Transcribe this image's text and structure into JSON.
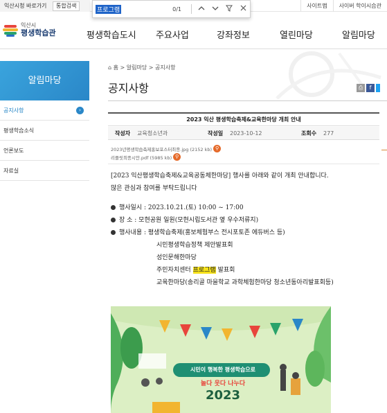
{
  "topbar": {
    "left_link": "익산시청 바로가기",
    "combo": "통합검색",
    "right_links": [
      "사이트맵",
      "사이버 학이시습관"
    ]
  },
  "findbar": {
    "query": "프로그램",
    "count": "0/1"
  },
  "header": {
    "logo_small": "익산시",
    "logo_big": "평생학습관",
    "nav": [
      "평생학습도시",
      "주요사업",
      "강좌정보",
      "열린마당",
      "알림마당"
    ]
  },
  "sidebar": {
    "title": "알림마당",
    "items": [
      "공지사항",
      "평생학습소식",
      "언론보도",
      "자료실"
    ]
  },
  "breadcrumb": "홈 > 알림마당 > 공지사항",
  "page_title": "공지사항",
  "post": {
    "title": "2023 익산 평생학습축제&교육한마당 개최 안내",
    "author_label": "작성자",
    "author": "교육청소년과",
    "date_label": "작성일",
    "date": "2023-10-12",
    "views_label": "조회수",
    "views": "277",
    "attachments": [
      "2023년평생학습축제홍보포스터최종.jpg (2152 kb)",
      "리플릿최종시안.pdf (5985 kb)"
    ],
    "intro_line1": "[2023 익산평생학습축제&교육공동체한마당] 행사를 아래와 같이 개최 안내합니다.",
    "intro_line2": "많은 관심과 참여를 부탁드립니다",
    "date_line": "행사일시 : 2023.10.21.(토) 10:00 ~ 17:00",
    "place_line": "장      소 : 모현공원 일원(모현시립도서관 옆 우수저류지)",
    "content_line": "행사내용 : 평생학습축제(홍보체험부스 전시포토존 에듀버스 등)",
    "sub1": "시민평생학습정책 제안발표회",
    "sub2": "성인문해한마당",
    "sub3_pre": "주민자치센터",
    "sub3_hl": "프로그램",
    "sub3_post": "발표회",
    "sub4": "교육한마당(송리골 마을학교 과학체험한마당  청소년동아리발표회등)"
  },
  "poster": {
    "banner": "시민이 행복한 평생학습으로",
    "tagline": "놀다 웃다 나누다",
    "year": "2023"
  },
  "colors": {
    "brand_blue": "#2a87c8",
    "find_highlight": "#1e63c8",
    "text_highlight": "#f5e11a"
  }
}
